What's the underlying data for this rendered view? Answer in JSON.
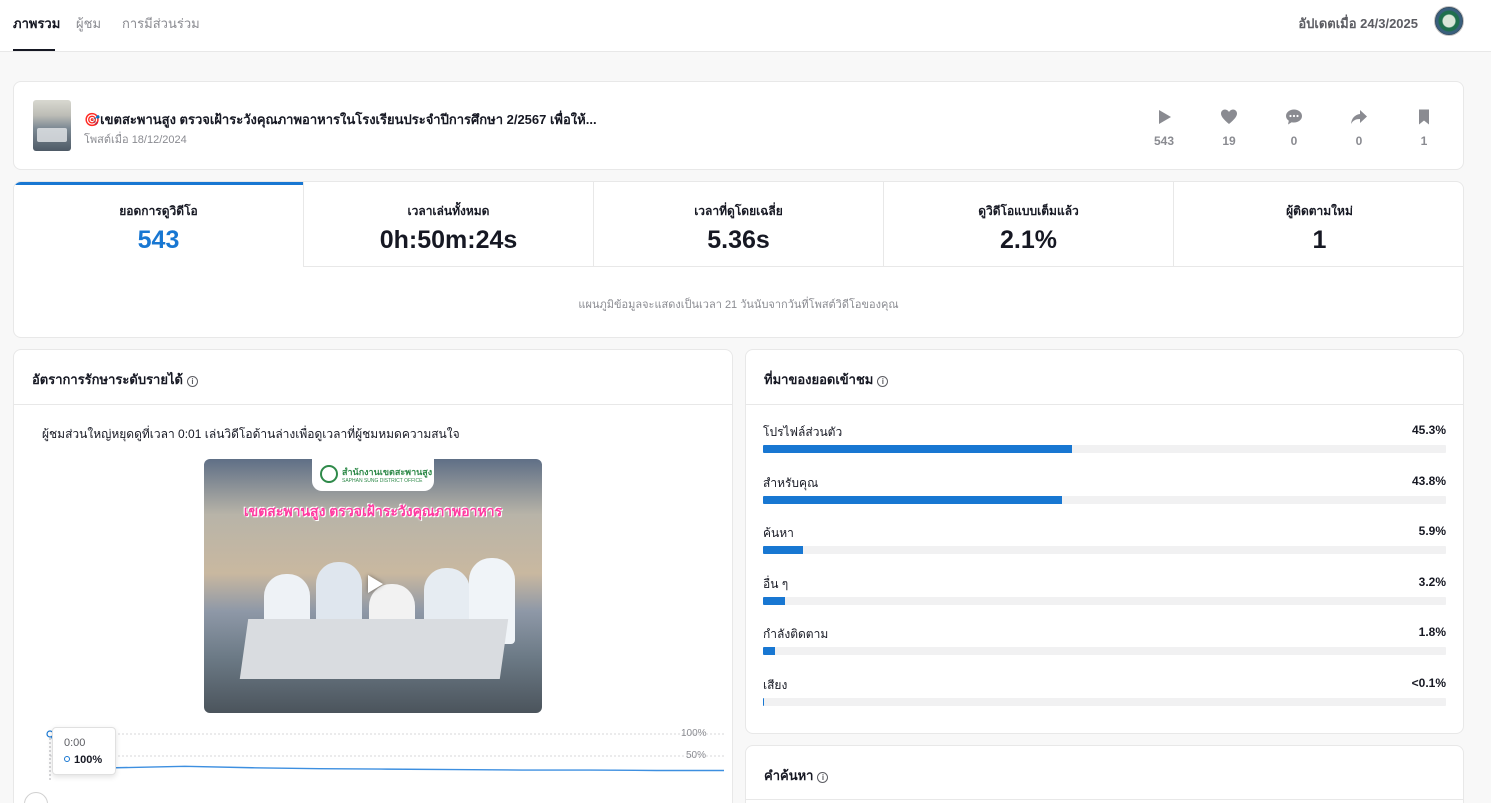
{
  "nav": {
    "tabs": [
      "ภาพรวม",
      "ผู้ชม",
      "การมีส่วนร่วม"
    ],
    "updated": "อัปเดตเมื่อ 24/3/2025"
  },
  "post": {
    "title": "🎯เขตสะพานสูง ตรวจเฝ้าระวังคุณภาพอาหารในโรงเรียนประจำปีการศึกษา 2/2567 เพื่อให้...",
    "date": "โพสต์เมื่อ 18/12/2024",
    "stats": {
      "views": "543",
      "likes": "19",
      "comments": "0",
      "shares": "0",
      "saves": "1"
    }
  },
  "metrics": {
    "items": [
      {
        "label": "ยอดการดูวิดีโอ",
        "value": "543"
      },
      {
        "label": "เวลาเล่นทั้งหมด",
        "value": "0h:50m:24s"
      },
      {
        "label": "เวลาที่ดูโดยเฉลี่ย",
        "value": "5.36s"
      },
      {
        "label": "ดูวิดีโอแบบเต็มแล้ว",
        "value": "2.1%"
      },
      {
        "label": "ผู้ติดตามใหม่",
        "value": "1"
      }
    ],
    "note": "แผนภูมิข้อมูลจะแสดงเป็นเวลา 21 วันนับจากวันที่โพสต์วิดีโอของคุณ"
  },
  "retention": {
    "title": "อัตราการรักษาระดับรายได้",
    "description": "ผู้ชมส่วนใหญ่หยุดดูที่เวลา 0:01 เล่นวิดีโอด้านล่างเพื่อดูเวลาที่ผู้ชมหมดความสนใจ",
    "video": {
      "banner_title": "สำนักงานเขตสะพานสูง",
      "banner_subtitle": "SAPHAN SUNG DISTRICT OFFICE",
      "caption": "เขตสะพานสูง ตรวจเฝ้าระวังคุณภาพอาหาร"
    },
    "tooltip": {
      "time": "0:00",
      "value": "100%"
    },
    "y_labels": [
      "100%",
      "50%"
    ],
    "curve": [
      100,
      55,
      34,
      31,
      29,
      28,
      27,
      26,
      26,
      25,
      25
    ]
  },
  "traffic": {
    "title": "ที่มาของยอดเข้าชม",
    "sources": [
      {
        "name": "โปรไฟล์ส่วนตัว",
        "pct": "45.3%",
        "value": 45.3
      },
      {
        "name": "สำหรับคุณ",
        "pct": "43.8%",
        "value": 43.8
      },
      {
        "name": "ค้นหา",
        "pct": "5.9%",
        "value": 5.9
      },
      {
        "name": "อื่น ๆ",
        "pct": "3.2%",
        "value": 3.2
      },
      {
        "name": "กำลังติดตาม",
        "pct": "1.8%",
        "value": 1.8
      },
      {
        "name": "เสียง",
        "pct": "<0.1%",
        "value": 0.05
      }
    ]
  },
  "search": {
    "title": "คำค้นหา"
  },
  "colors": {
    "accent": "#1877d2",
    "text": "#161823",
    "muted": "#8a8b91"
  }
}
